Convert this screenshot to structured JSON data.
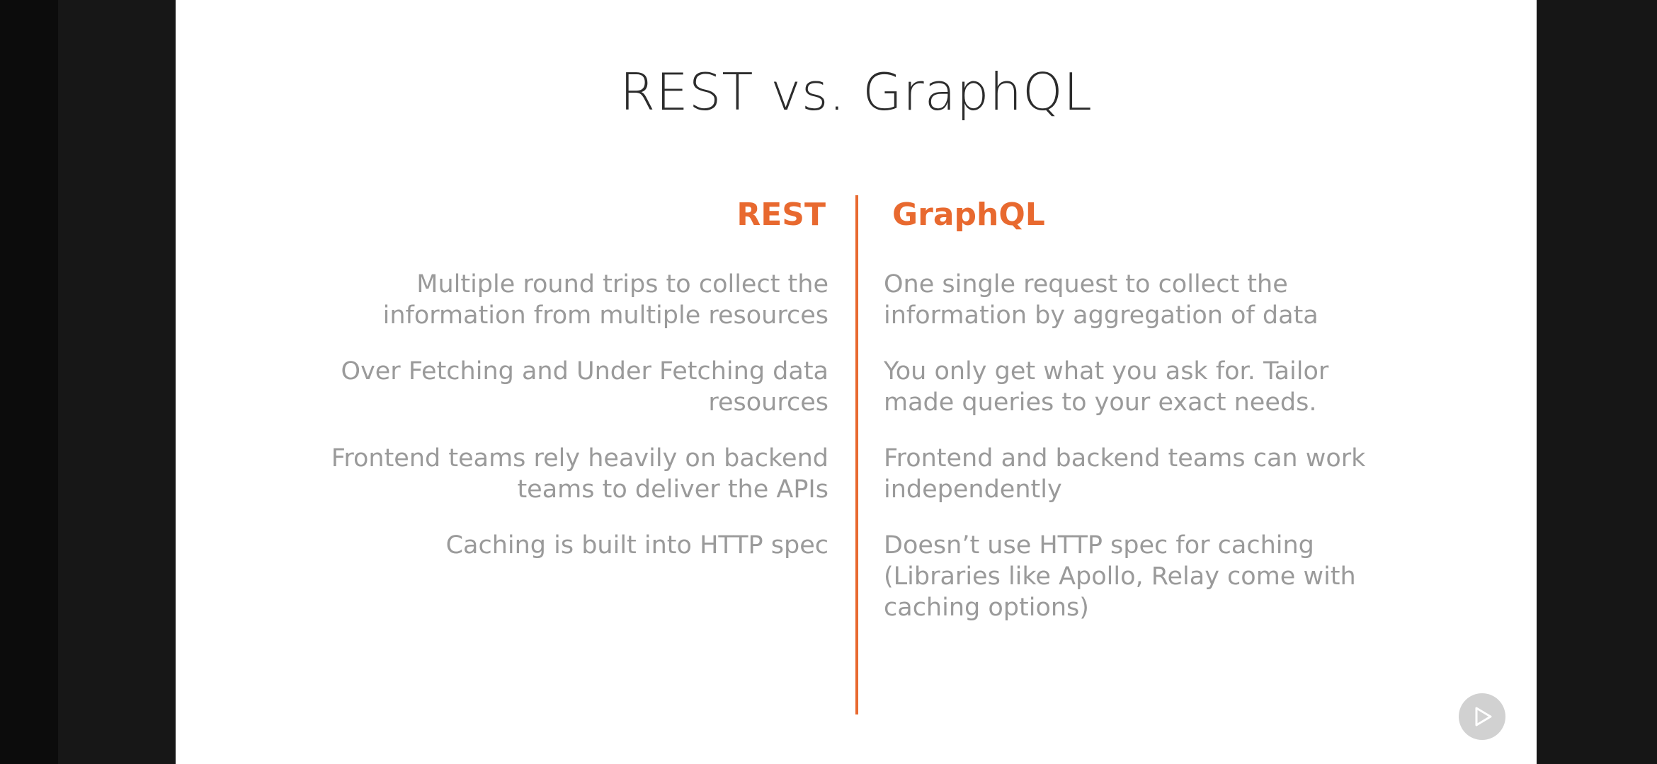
{
  "slide": {
    "title": "REST vs. GraphQL",
    "left_header": "REST",
    "right_header": "GraphQL",
    "rows": [
      {
        "rest": "Multiple round trips to collect the\ninformation from multiple resources",
        "graphql": "One single request to collect the\ninformation by aggregation of data"
      },
      {
        "rest": "Over Fetching and Under Fetching data\nresources",
        "graphql": "You only get what you ask for. Tailor\nmade queries to your exact needs."
      },
      {
        "rest": "Frontend teams rely heavily on backend\nteams to deliver the APIs",
        "graphql": "Frontend and backend teams can work\nindependently"
      },
      {
        "rest": "Caching is built into HTTP spec",
        "graphql": "Doesn’t use HTTP spec for caching\n(Libraries like Apollo, Relay come with\ncaching options)"
      }
    ]
  },
  "colors": {
    "accent": "#e8692f",
    "title": "#2c2c2c",
    "body_text": "#9a9a9a",
    "background": "#ffffff"
  },
  "controls": {
    "play_icon": "play-icon"
  }
}
